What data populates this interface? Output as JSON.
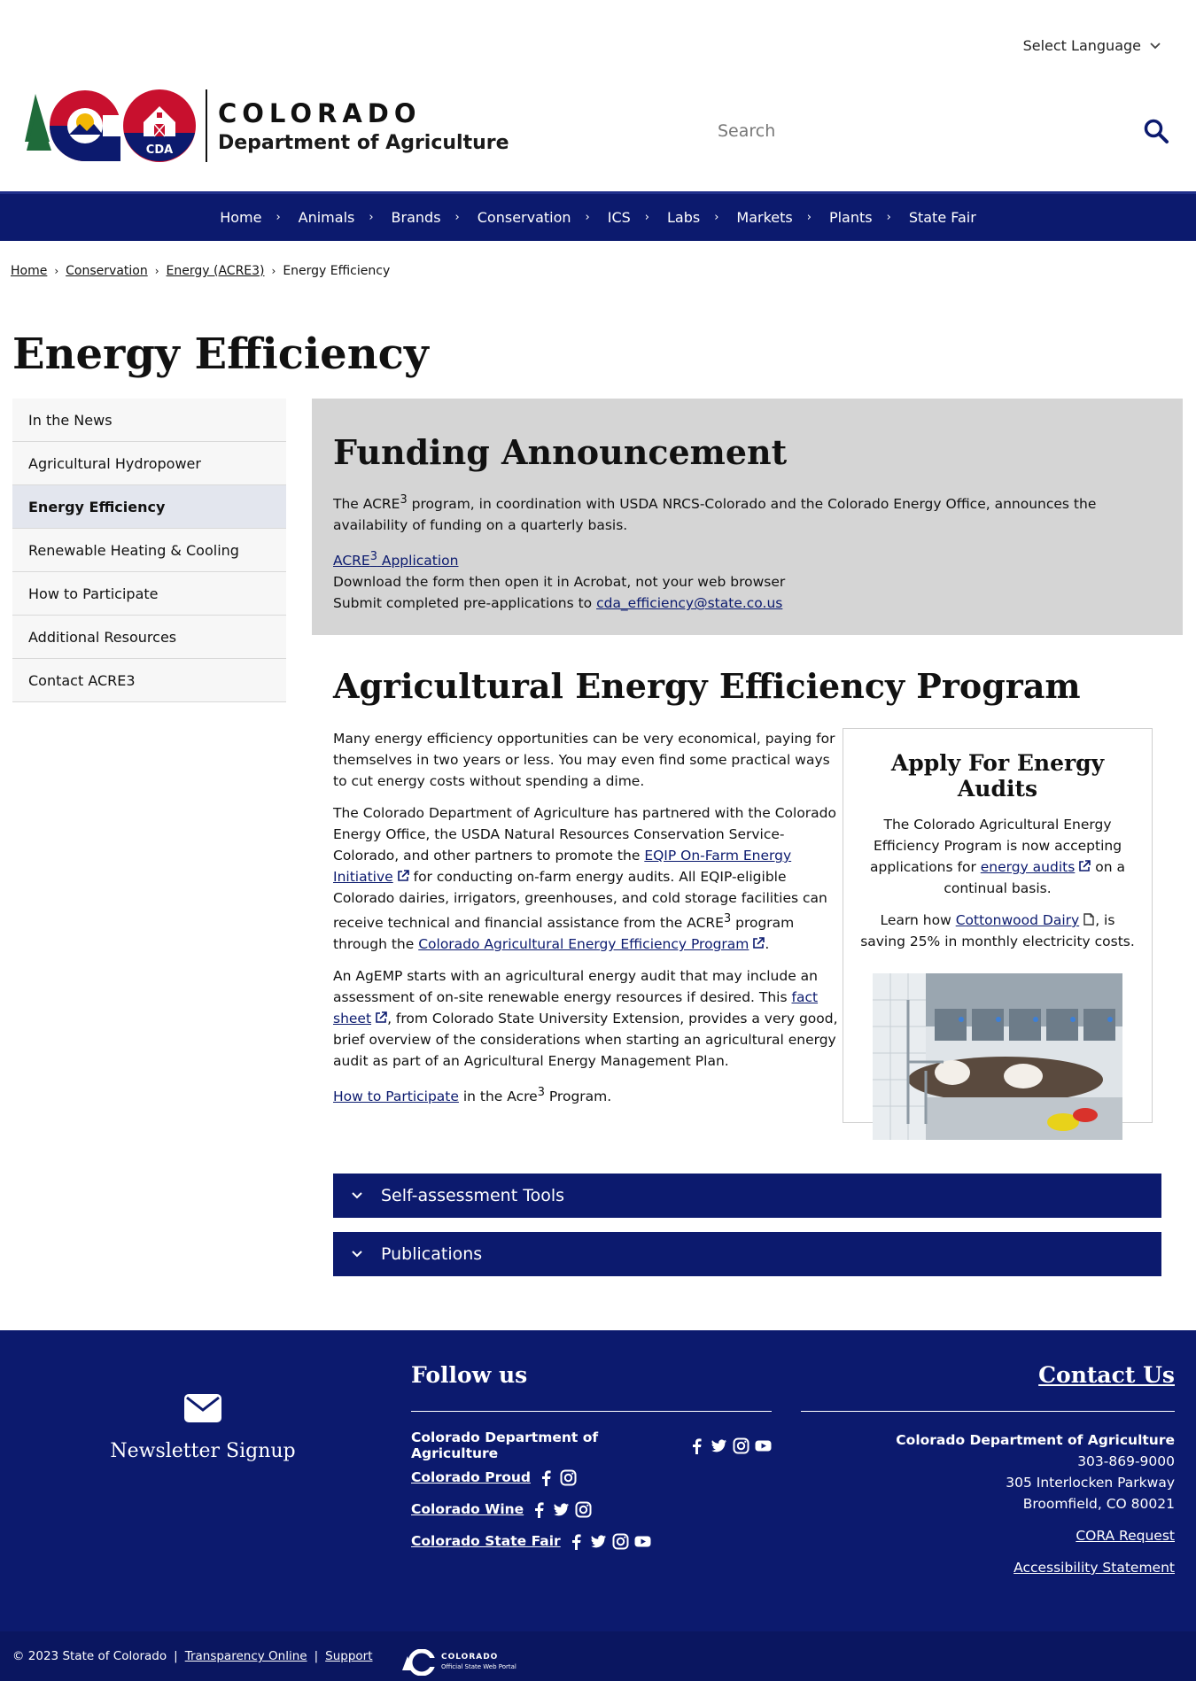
{
  "header": {
    "language_label": "Select Language",
    "logo_colorado": "COLORADO",
    "logo_department": "Department of Agriculture",
    "logo_badge": "CDA",
    "search_placeholder": "Search"
  },
  "nav": {
    "items": [
      "Home",
      "Animals",
      "Brands",
      "Conservation",
      "ICS",
      "Labs",
      "Markets",
      "Plants",
      "State Fair"
    ]
  },
  "breadcrumb": {
    "items": [
      "Home",
      "Conservation",
      "Energy (ACRE3)"
    ],
    "current": "Energy Efficiency"
  },
  "page_title": "Energy Efficiency",
  "sidenav": {
    "items": [
      "In the News",
      "Agricultural Hydropower",
      "Energy Efficiency",
      "Renewable Heating & Cooling",
      "How to Participate",
      "Additional Resources",
      "Contact ACRE3"
    ],
    "active": "Energy Efficiency"
  },
  "funding": {
    "title": "Funding Announcement",
    "p1_a": "The ACRE",
    "p1_sup": "3",
    "p1_b": " program, in coordination with USDA NRCS-Colorado and the Colorado Energy Office, announces the availability of funding on a quarterly basis.",
    "app_link_a": "ACRE",
    "app_link_sup": "3",
    "app_link_b": " Application",
    "download_note": "Download the form then open it in Acrobat, not your web browser",
    "submit_text": "Submit completed pre-applications to ",
    "submit_email": "cda_efficiency@state.co.us"
  },
  "main": {
    "title": "Agricultural Energy Efficiency Program",
    "p1": "Many energy efficiency opportunities can be very economical, paying for themselves in two years or less. You may even find some practical ways to cut energy costs without spending a dime.",
    "p2_a": "The Colorado Department of Agriculture has partnered with the Colorado Energy Office, the USDA Natural Resources Conservation Service-Colorado, and other partners to promote the ",
    "p2_link1": "EQIP On-Farm Energy Initiative",
    "p2_b": " for conducting on-farm energy audits. All EQIP-eligible Colorado dairies, irrigators, greenhouses, and cold storage facilities can receive technical and financial assistance from the ACRE",
    "p2_sup": "3",
    "p2_c": " program through the ",
    "p2_link2": "Colorado Agricultural Energy Efficiency Program",
    "p2_d": ".",
    "p3_a": "An AgEMP starts with an agricultural energy audit that may include an assessment of on-site renewable energy resources if desired. This ",
    "p3_link": "fact sheet",
    "p3_b": ", from Colorado State University Extension, provides a very good, brief overview of the considerations when starting an agricultural energy audit as part of an Agricultural Energy Management Plan.",
    "p4_link": "How to Participate",
    "p4_a": " in the Acre",
    "p4_sup": "3",
    "p4_b": " Program."
  },
  "sidebox": {
    "title": "Apply For Energy Audits",
    "p1_a": "The Colorado Agricultural Energy Efficiency Program is now accepting applications for ",
    "p1_link": "energy audits",
    "p1_b": " on a continual basis.",
    "p2_a": "Learn how ",
    "p2_link": "Cottonwood Dairy",
    "p2_b": ", is saving 25% in monthly electricity costs."
  },
  "accordions": [
    "Self-assessment Tools",
    "Publications"
  ],
  "footer": {
    "newsletter": "Newsletter Signup",
    "follow_title": "Follow us",
    "follow_rows": [
      {
        "label": "Colorado Department of Agriculture",
        "icons": [
          "facebook-icon",
          "twitter-icon",
          "instagram-icon",
          "youtube-icon"
        ]
      },
      {
        "label": "Colorado Proud",
        "icons": [
          "facebook-icon",
          "instagram-icon"
        ]
      },
      {
        "label": "Colorado Wine",
        "icons": [
          "facebook-icon",
          "twitter-icon",
          "instagram-icon"
        ]
      },
      {
        "label": "Colorado State Fair",
        "icons": [
          "facebook-icon",
          "twitter-icon",
          "instagram-icon",
          "youtube-icon"
        ]
      }
    ],
    "contact_title": "Contact Us",
    "contact_org": "Colorado Department of Agriculture",
    "contact_phone": "303-869-9000",
    "contact_addr1": "305 Interlocken Parkway",
    "contact_addr2": "Broomfield, CO 80021",
    "cora": "CORA Request",
    "accessibility": "Accessibility Statement"
  },
  "bottombar": {
    "copyright": "© 2023 State of Colorado",
    "sep": "|",
    "transparency": "Transparency Online",
    "support": "Support",
    "portal_title": "COLORADO",
    "portal_sub": "Official State Web Portal"
  },
  "colors": {
    "navy": "#0c1a6e",
    "funding_bg": "#d5d5d5",
    "sidenav_active": "#e3e6ee"
  }
}
